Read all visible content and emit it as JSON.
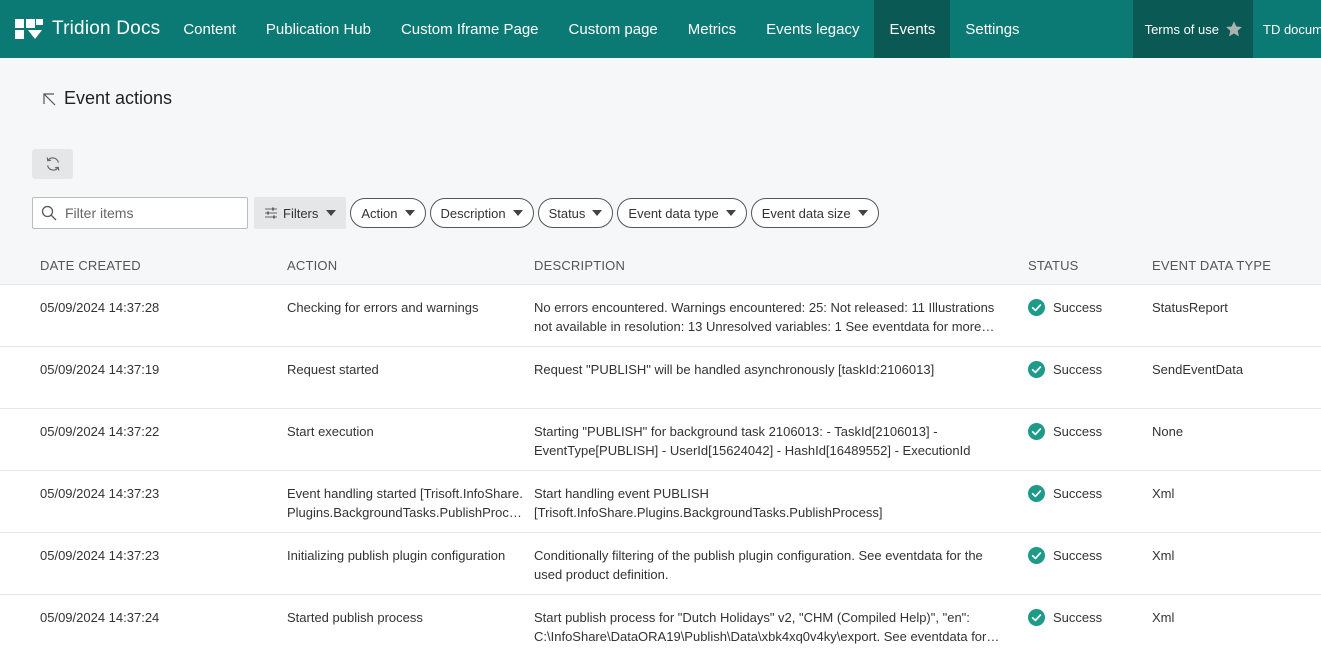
{
  "brand": {
    "name": "Tridion Docs"
  },
  "nav": {
    "items": [
      {
        "label": "Content",
        "active": false
      },
      {
        "label": "Publication Hub",
        "active": false
      },
      {
        "label": "Custom Iframe Page",
        "active": false
      },
      {
        "label": "Custom page",
        "active": false
      },
      {
        "label": "Metrics",
        "active": false
      },
      {
        "label": "Events legacy",
        "active": false
      },
      {
        "label": "Events",
        "active": true
      },
      {
        "label": "Settings",
        "active": false
      }
    ],
    "terms_label": "Terms of use",
    "docs_label": "TD documentation"
  },
  "page": {
    "title": "Event actions"
  },
  "filters": {
    "search_placeholder": "Filter items",
    "filters_label": "Filters",
    "pills": [
      "Action",
      "Description",
      "Status",
      "Event data type",
      "Event data size"
    ]
  },
  "table": {
    "headers": {
      "date": "DATE CREATED",
      "action": "ACTION",
      "description": "DESCRIPTION",
      "status": "STATUS",
      "type": "EVENT DATA TYPE"
    },
    "rows": [
      {
        "date": "05/09/2024 14:37:28",
        "action": "Checking for errors and warnings",
        "description": "No errors encountered. Warnings encountered: 25: Not released: 11 Illustrations not available in resolution: 13 Unresolved variables: 1 See eventdata for more details",
        "status": "Success",
        "type": "StatusReport"
      },
      {
        "date": "05/09/2024 14:37:19",
        "action": "Request started",
        "description": "Request \"PUBLISH\" will be handled asynchronously [taskId:2106013]",
        "status": "Success",
        "type": "SendEventData"
      },
      {
        "date": "05/09/2024 14:37:22",
        "action": "Start execution",
        "description": "Starting \"PUBLISH\" for background task 2106013: - TaskId[2106013] - EventType[PUBLISH] - UserId[15624042] - HashId[16489552] - ExecutionId",
        "status": "Success",
        "type": "None"
      },
      {
        "date": "05/09/2024 14:37:23",
        "action": "Event handling started [Trisoft.InfoShare.Plugins.BackgroundTasks.PublishProcess]",
        "description": "Start handling event PUBLISH [Trisoft.InfoShare.Plugins.BackgroundTasks.PublishProcess]",
        "status": "Success",
        "type": "Xml"
      },
      {
        "date": "05/09/2024 14:37:23",
        "action": "Initializing publish plugin configuration",
        "description": "Conditionally filtering of the publish plugin configuration. See eventdata for the used product definition.",
        "status": "Success",
        "type": "Xml"
      },
      {
        "date": "05/09/2024 14:37:24",
        "action": "Started publish process",
        "description": "Start publish process for \"Dutch Holidays\" v2, \"CHM (Compiled Help)\", \"en\": C:\\InfoShare\\DataORA19\\Publish\\Data\\xbk4xq0v4ky\\export. See eventdata for more details",
        "status": "Success",
        "type": "Xml"
      }
    ]
  },
  "colors": {
    "header": "#0c7a74",
    "header_active": "#0a5955",
    "success": "#1d9a88"
  }
}
